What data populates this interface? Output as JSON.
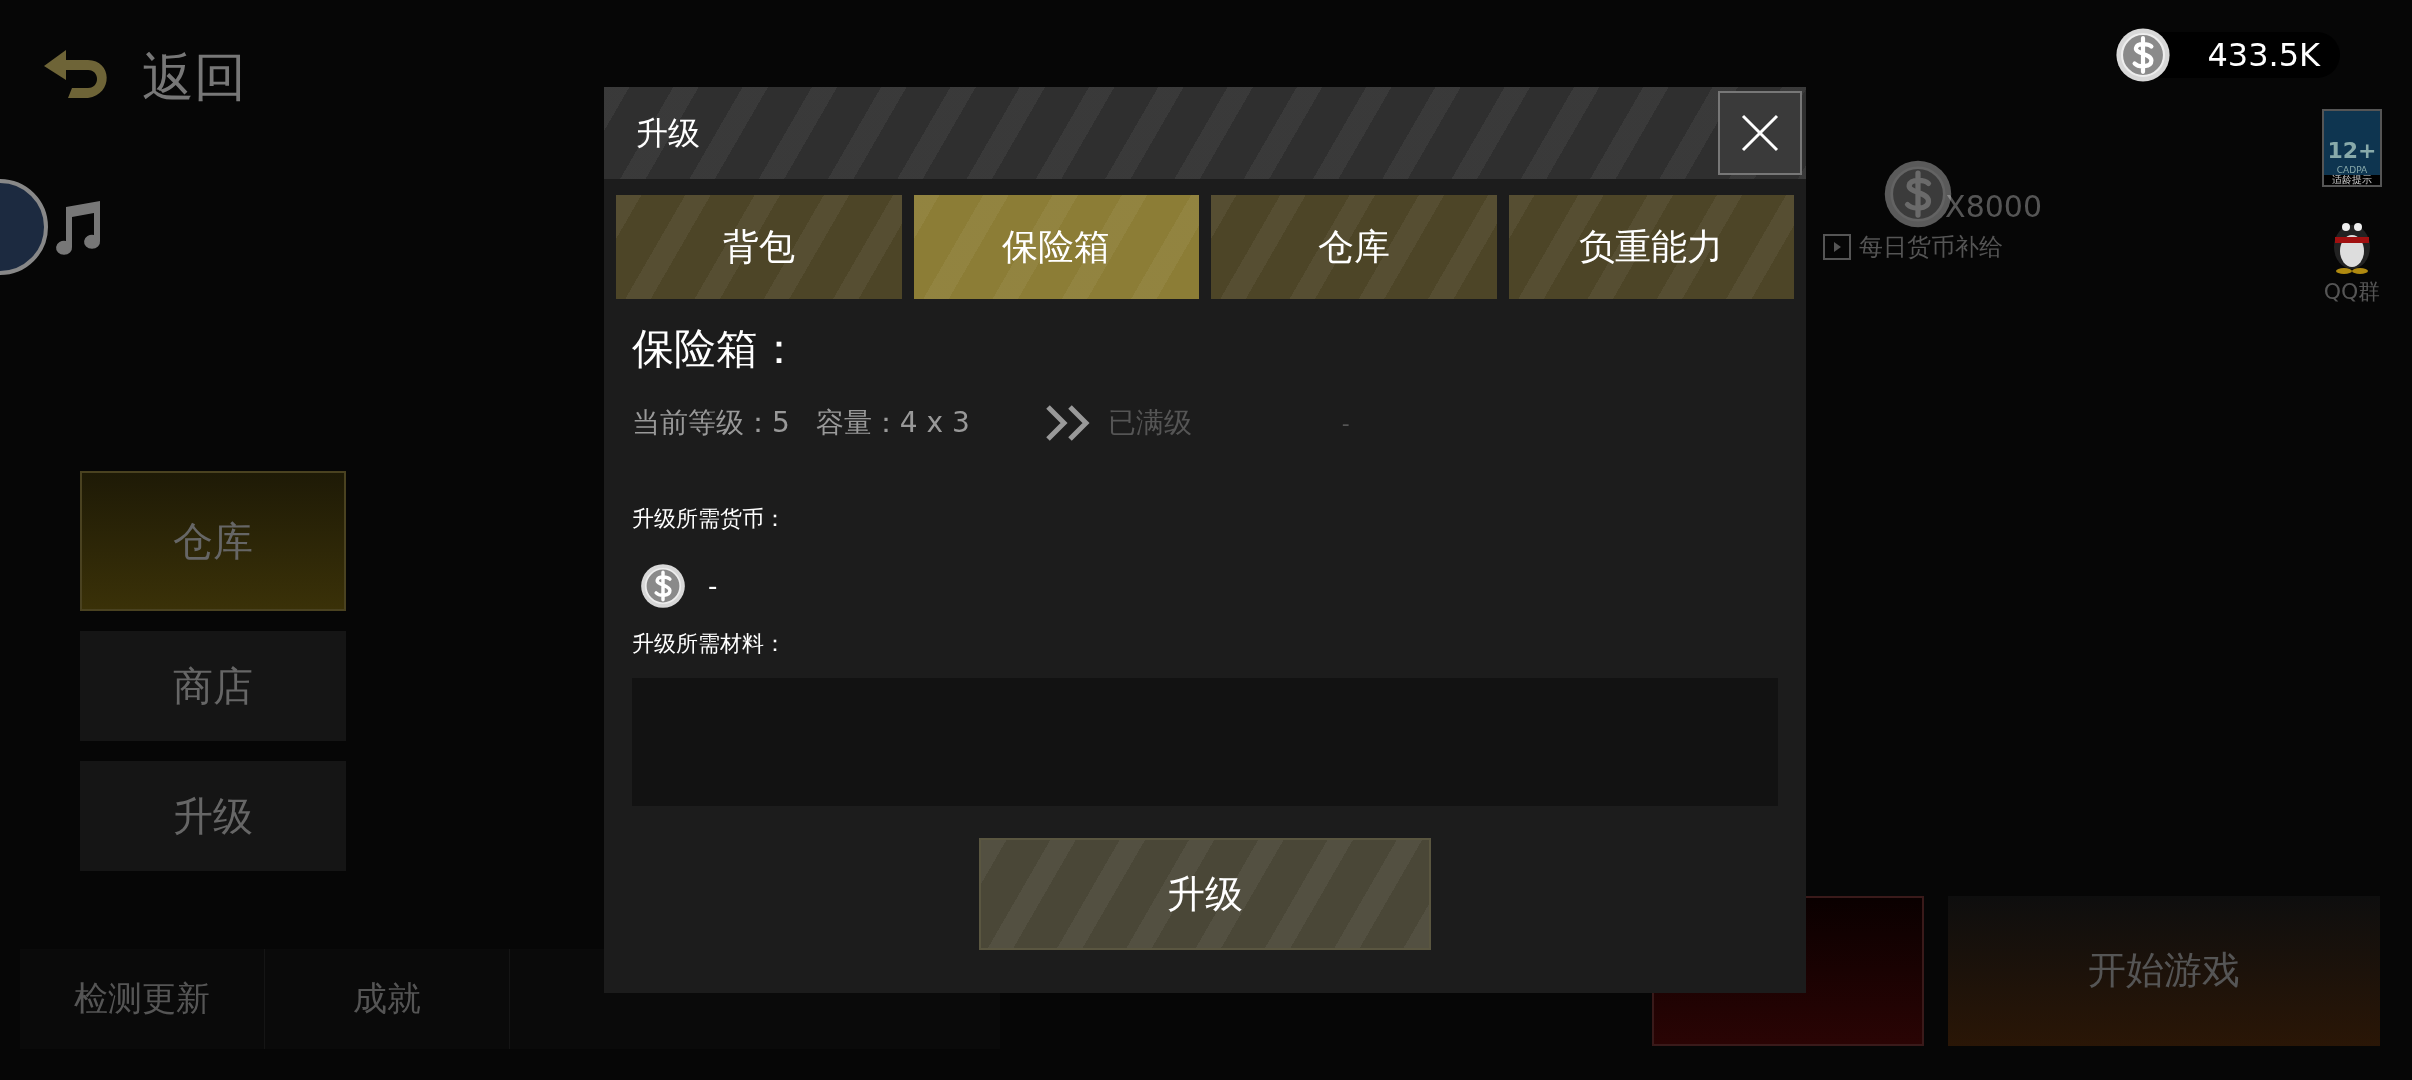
{
  "back": {
    "label": "返回"
  },
  "balance": "433.5K",
  "daily_supply": {
    "amount": "X8000",
    "label": "每日货币补给"
  },
  "age_badge": {
    "rating": "12+",
    "org": "CADPA",
    "note": "适龄提示"
  },
  "qq": {
    "label": "QQ群"
  },
  "side_menu": [
    {
      "label": "仓库",
      "selected": true
    },
    {
      "label": "商店",
      "selected": false
    },
    {
      "label": "升级",
      "selected": false
    }
  ],
  "bottom_menu": [
    "检测更新",
    "成就"
  ],
  "action_buttons": [
    {
      "kind": "insure"
    },
    {
      "label": "开始游戏",
      "kind": "start"
    }
  ],
  "dialog": {
    "title": "升级",
    "tabs": [
      {
        "label": "背包",
        "selected": false
      },
      {
        "label": "保险箱",
        "selected": true
      },
      {
        "label": "仓库",
        "selected": false
      },
      {
        "label": "负重能力",
        "selected": false
      }
    ],
    "section_title": "保险箱：",
    "current_level": "当前等级：5",
    "capacity": "容量：4 x 3",
    "next_level": "已满级",
    "next_capacity": "-",
    "currency_label": "升级所需货币：",
    "currency_cost": "-",
    "materials_label": "升级所需材料：",
    "upgrade_button": "升级"
  }
}
